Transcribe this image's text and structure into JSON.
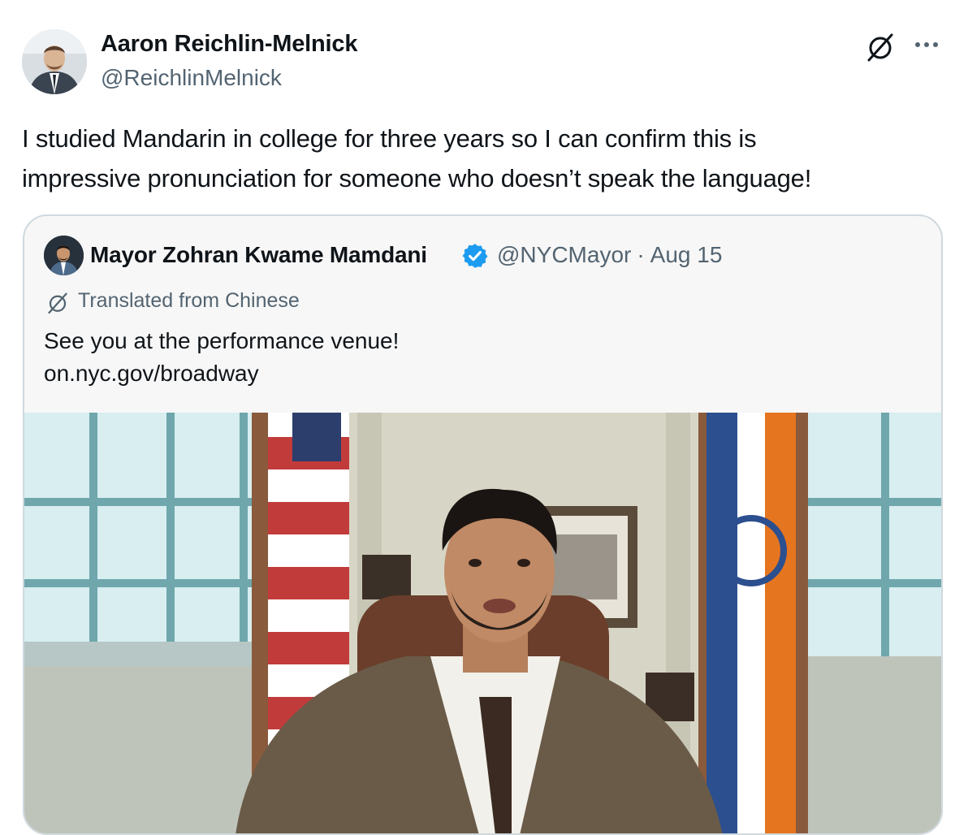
{
  "author": {
    "name": "Aaron Reichlin-Melnick",
    "handle": "@ReichlinMelnick",
    "avatar_icon": "profile-photo"
  },
  "actions": {
    "grok_icon": "grok-slash-circle-icon",
    "more_icon": "more-dots-icon"
  },
  "tweet": {
    "lines": [
      "I studied Mandarin in college for three years so I can confirm this is",
      "impressive pronunciation for someone who doesn’t  speak the language!"
    ]
  },
  "quote": {
    "name": "Mayor Zohran Kwame Mamdani",
    "verified_icon": "verified-badge-icon",
    "verified_color": "#1d9bf0",
    "handle": "@NYCMayor",
    "separator": "·",
    "date": "Aug 15",
    "translated": "Translated from Chinese",
    "text_lines": [
      "See you at the performance venue!",
      "on.nyc.gov/broadway"
    ],
    "media": "video-thumbnail"
  },
  "colors": {
    "text": "#0f1419",
    "muted": "#536471",
    "border": "#cfd9de",
    "card_bg": "#f7f7f7"
  }
}
